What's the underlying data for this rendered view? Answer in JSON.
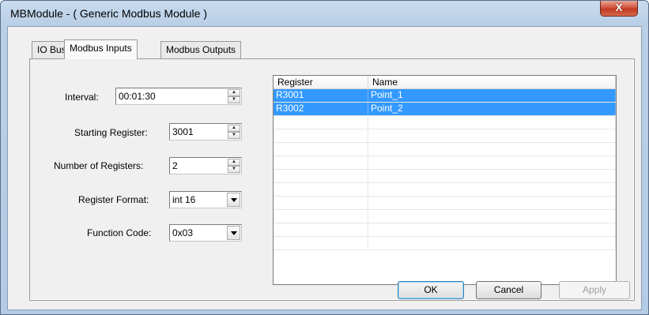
{
  "window": {
    "title": "MBModule - ( Generic Modbus Module )",
    "close_label": "X"
  },
  "tabs": [
    {
      "label": "IO Bus"
    },
    {
      "label": "Modbus Inputs"
    },
    {
      "label": "Modbus Outputs"
    }
  ],
  "form": {
    "interval": {
      "label": "Interval:",
      "value": "00:01:30"
    },
    "starting_register": {
      "label": "Starting Register:",
      "value": "3001"
    },
    "number_of_registers": {
      "label": "Number of Registers:",
      "value": "2"
    },
    "register_format": {
      "label": "Register Format:",
      "value": "int 16"
    },
    "function_code": {
      "label": "Function Code:",
      "value": "0x03"
    }
  },
  "list": {
    "columns": [
      "Register",
      "Name"
    ],
    "rows": [
      {
        "register": "R3001",
        "name": "Point_1",
        "selected": true
      },
      {
        "register": "R3002",
        "name": "Point_2",
        "selected": true
      }
    ],
    "empty_rows": 10
  },
  "buttons": {
    "ok": "OK",
    "cancel": "Cancel",
    "apply": "Apply"
  },
  "icons": {
    "spin_up": "spin-up-icon",
    "spin_down": "spin-down-icon",
    "dropdown": "dropdown-arrow-icon"
  },
  "colors": {
    "selection": "#3399ff",
    "titlebar": "#c9dcef",
    "close": "#c23a22"
  }
}
